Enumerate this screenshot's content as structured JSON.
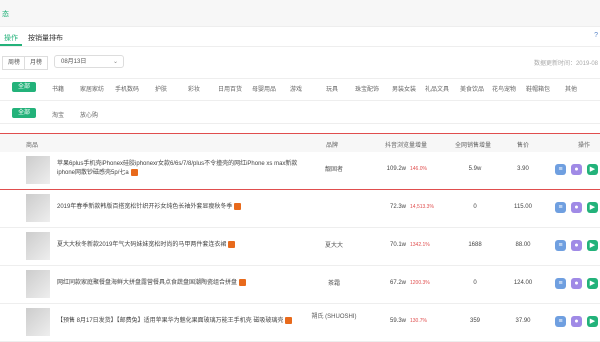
{
  "top": {
    "label": "态"
  },
  "tabs": [
    {
      "label": "操作"
    },
    {
      "label": "按销量排布"
    }
  ],
  "help": "?",
  "period": {
    "week": "周榜",
    "month": "月榜",
    "date": "08月13日",
    "chev": "⌄"
  },
  "update_time": "数据更新时间：2019-08",
  "cat_chip": "全部",
  "categories": [
    "书籍",
    "家居家纺",
    "手机数码",
    "护肤",
    "彩妆",
    "日用百货",
    "母婴用品",
    "游戏",
    "玩具",
    "珠宝配饰",
    "男装女装",
    "礼品文具",
    "美食饮品",
    "花鸟宠物",
    "鞋帽箱包",
    "其他"
  ],
  "sub_chip": "全部",
  "subs": [
    "淘宝",
    "放心购"
  ],
  "headers": {
    "product": "商品",
    "brand": "品牌",
    "pv": "抖音浏览量增量",
    "sales": "全网销售增量",
    "price": "售价",
    "ops": "操作"
  },
  "rows": [
    {
      "title": "苹果6plus手机壳iPhonex硅胶iphonexr女款6/6s/7/8/plus不令撞壳的网红iPhone xs max新款iphone网散钞磁感壳5p/七a",
      "brand": "靓固者",
      "pv": "109.2w",
      "pct": "146.0%",
      "sales": "5.9w",
      "price": "3.90"
    },
    {
      "title": "2019年春季新款韩版百搭宽松针织开衫女纯色长袖外套显瘦秋冬季",
      "brand": "",
      "pv": "72.3w",
      "pct": "14,513.3%",
      "sales": "0",
      "price": "115.00"
    },
    {
      "title": "夏大大秋冬新款2019年气大码妹妹宽松时尚的马甲两件套连衣裙",
      "brand": "夏大大",
      "pv": "70.1w",
      "pct": "1342.1%",
      "sales": "1688",
      "price": "88.00"
    },
    {
      "title": "网红同款家庭聚餐盘海鲜大拼盘露营餐具点食蔬盘国潮陶瓷组合拼盘",
      "brand": "茶霜",
      "pv": "67.2w",
      "pct": "1200.3%",
      "sales": "0",
      "price": "124.00"
    },
    {
      "title": "【预售 8月17日发货】【邮费兔】适用苹果华为魅化果面玻璃万能王手机壳 磁吸玻璃壳",
      "brand": "朔氏 (SHUOSHI)",
      "pv": "59.3w",
      "pct": "130.7%",
      "sales": "359",
      "price": "37.90"
    }
  ],
  "op_icons": [
    "chart-icon",
    "user-icon",
    "play-icon"
  ]
}
